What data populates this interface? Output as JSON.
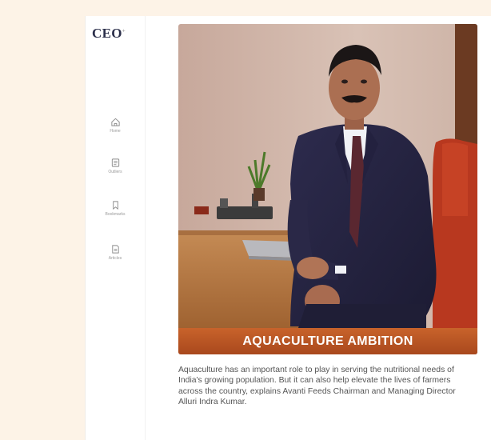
{
  "brand": {
    "logo_text": "CEO",
    "logo_mark": "+"
  },
  "sidebar": {
    "items": [
      {
        "label": "Home",
        "icon": "home-icon"
      },
      {
        "label": "Outliers",
        "icon": "list-icon"
      },
      {
        "label": "Bookmarks",
        "icon": "bookmark-icon"
      },
      {
        "label": "Articles",
        "icon": "article-icon"
      }
    ]
  },
  "article": {
    "title": "AQUACULTURE AMBITION",
    "summary": "Aquaculture has an important role to play in serving the nutritional needs of India's growing population. But it can also help elevate the lives of farmers across the country, explains Avanti Feeds Chairman and Managing Director Alluri Indra Kumar.",
    "accent_color": "#b8531f"
  }
}
